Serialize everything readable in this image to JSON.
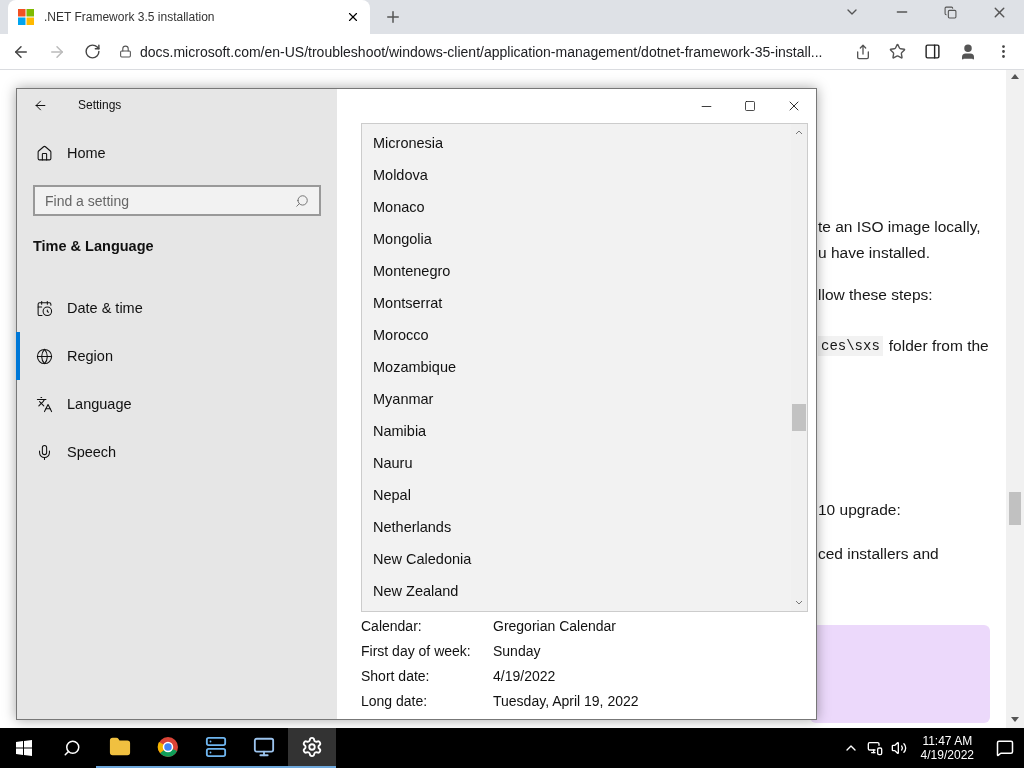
{
  "browser": {
    "tab_title": ".NET Framework 3.5 installation",
    "url": "docs.microsoft.com/en-US/troubleshoot/windows-client/application-management/dotnet-framework-35-install..."
  },
  "page": {
    "lines": [
      {
        "text": "te an ISO image locally,"
      },
      {
        "text": "u have installed."
      },
      {
        "text": "llow these steps:"
      },
      {
        "code": "ces\\sxs",
        "text": "folder from the"
      },
      {
        "text": "10 upgrade:"
      },
      {
        "text": "ced installers and"
      }
    ]
  },
  "settings": {
    "title": "Settings",
    "home": "Home",
    "search": {
      "placeholder": "Find a setting"
    },
    "section": "Time & Language",
    "nav": [
      {
        "kind": "calendar",
        "label": "Date & time",
        "selected": false
      },
      {
        "kind": "globe",
        "label": "Region",
        "selected": true
      },
      {
        "kind": "language",
        "label": "Language",
        "selected": false
      },
      {
        "kind": "microphone",
        "label": "Speech",
        "selected": false
      }
    ],
    "region_list": [
      "Micronesia",
      "Moldova",
      "Monaco",
      "Mongolia",
      "Montenegro",
      "Montserrat",
      "Morocco",
      "Mozambique",
      "Myanmar",
      "Namibia",
      "Nauru",
      "Nepal",
      "Netherlands",
      "New Caledonia",
      "New Zealand"
    ],
    "formats": [
      {
        "label": "Calendar:",
        "value": "Gregorian Calendar"
      },
      {
        "label": "First day of week:",
        "value": "Sunday"
      },
      {
        "label": "Short date:",
        "value": "4/19/2022"
      },
      {
        "label": "Long date:",
        "value": "Tuesday, April 19, 2022"
      }
    ]
  },
  "taskbar": {
    "apps": [
      {
        "kind": "folder",
        "selected": false
      },
      {
        "kind": "chrome",
        "selected": false
      },
      {
        "kind": "server",
        "selected": false
      },
      {
        "kind": "monitor",
        "selected": false
      },
      {
        "kind": "gear",
        "selected": true
      }
    ],
    "time": "11:47 AM",
    "date": "4/19/2022"
  }
}
